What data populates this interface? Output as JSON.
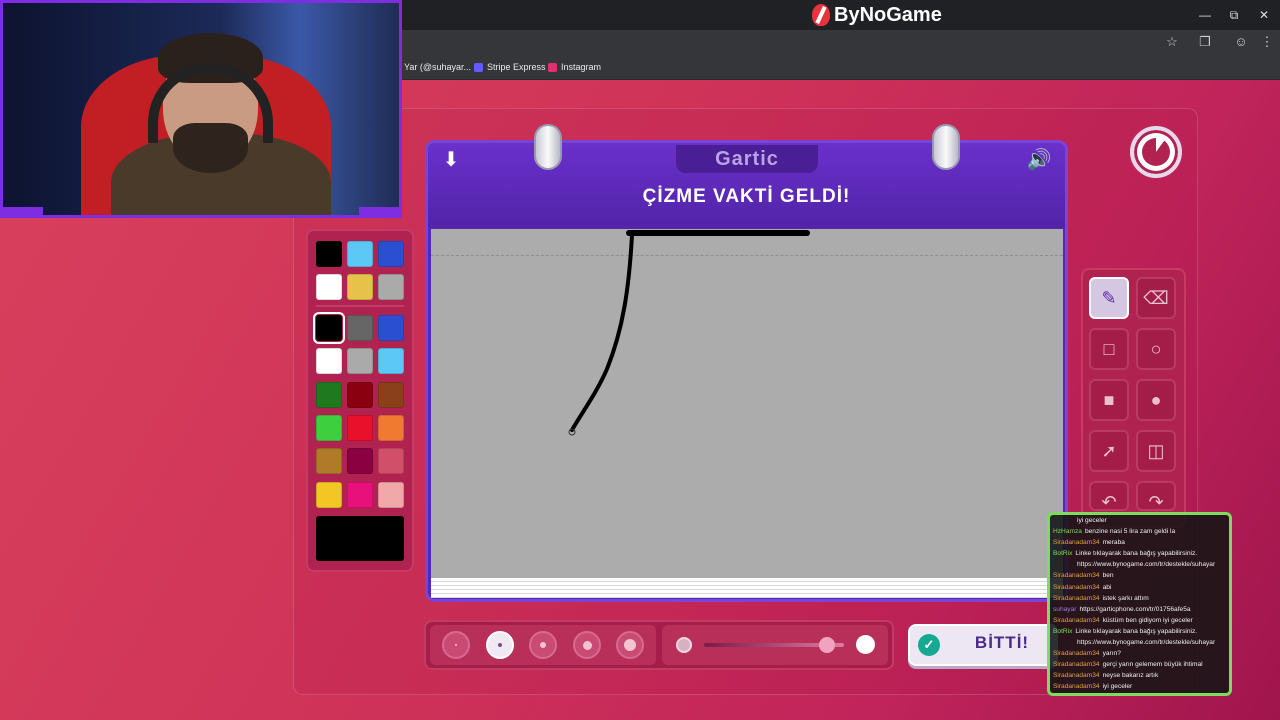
{
  "browser": {
    "brand_name": "ByNoGame",
    "bookmarks": [
      {
        "label": "Yar (@suhayar...",
        "icon": "x-icon"
      },
      {
        "label": "Stripe Express",
        "icon": "stripe-icon",
        "color": "#635bff"
      },
      {
        "label": "Instagram",
        "icon": "instagram-icon",
        "color": "#e1306c"
      }
    ]
  },
  "game": {
    "logo_text": "Gartic",
    "headline": "ÇİZME VAKTİ GELDİ!",
    "done_label": "BİTTİ!",
    "opacity_level": 0.88,
    "timer_remaining": 0.9
  },
  "palette": {
    "recent": [
      "#000000",
      "#5bc8f5",
      "#2a4fd0",
      "#ffffff",
      "#e6c24a",
      "#aaaaaa"
    ],
    "colors": [
      "#000000",
      "#666666",
      "#2a4fd0",
      "#ffffff",
      "#aaaaaa",
      "#5bc8f5",
      "#1f7a1f",
      "#8b0010",
      "#8a4018",
      "#3ecf3e",
      "#e8102a",
      "#f07a30",
      "#b07a28",
      "#8a0040",
      "#d0506a",
      "#f3c624",
      "#e8107a",
      "#f0a8a8"
    ],
    "selected": "#000000"
  },
  "tools": [
    "pencil",
    "eraser",
    "square-outline",
    "circle-outline",
    "square-filled",
    "circle-filled",
    "line",
    "fill-bucket",
    "undo",
    "redo"
  ],
  "chat": [
    {
      "user": "",
      "user_color": "gold",
      "msg": "iyi geceler"
    },
    {
      "user": "HzHamza",
      "user_color": "hz",
      "msg": "benzine nasi 5 lira zam geldi la"
    },
    {
      "user": "Siradanadam34",
      "user_color": "gold",
      "msg": "meraba"
    },
    {
      "user": "BotRix",
      "user_color": "green",
      "msg": "Linke tıklayarak bana bağış yapabilirsiniz."
    },
    {
      "user": "",
      "user_color": "green",
      "msg": "https://www.bynogame.com/tr/destekle/suhayar"
    },
    {
      "user": "Siradanadam34",
      "user_color": "gold",
      "msg": "ben"
    },
    {
      "user": "Siradanadam34",
      "user_color": "gold",
      "msg": "abi"
    },
    {
      "user": "Siradanadam34",
      "user_color": "gold",
      "msg": "istek şarkı attım"
    },
    {
      "user": "suhayar",
      "user_color": "purple",
      "msg": "https://garticphone.com/tr/01756afe5a"
    },
    {
      "user": "Siradanadam34",
      "user_color": "gold",
      "msg": "küstüm ben gidiyom iyi geceler"
    },
    {
      "user": "BotRix",
      "user_color": "green",
      "msg": "Linke tıklayarak bana bağış yapabilirsiniz."
    },
    {
      "user": "",
      "user_color": "green",
      "msg": "https://www.bynogame.com/tr/destekle/suhayar"
    },
    {
      "user": "Siradanadam34",
      "user_color": "gold",
      "msg": "yarın?"
    },
    {
      "user": "Siradanadam34",
      "user_color": "gold",
      "msg": "gerçi yarın gelemem büyük ihtimal"
    },
    {
      "user": "Siradanadam34",
      "user_color": "gold",
      "msg": "neyse bakarız artık"
    },
    {
      "user": "Siradanadam34",
      "user_color": "gold",
      "msg": "iyi geceler"
    }
  ]
}
